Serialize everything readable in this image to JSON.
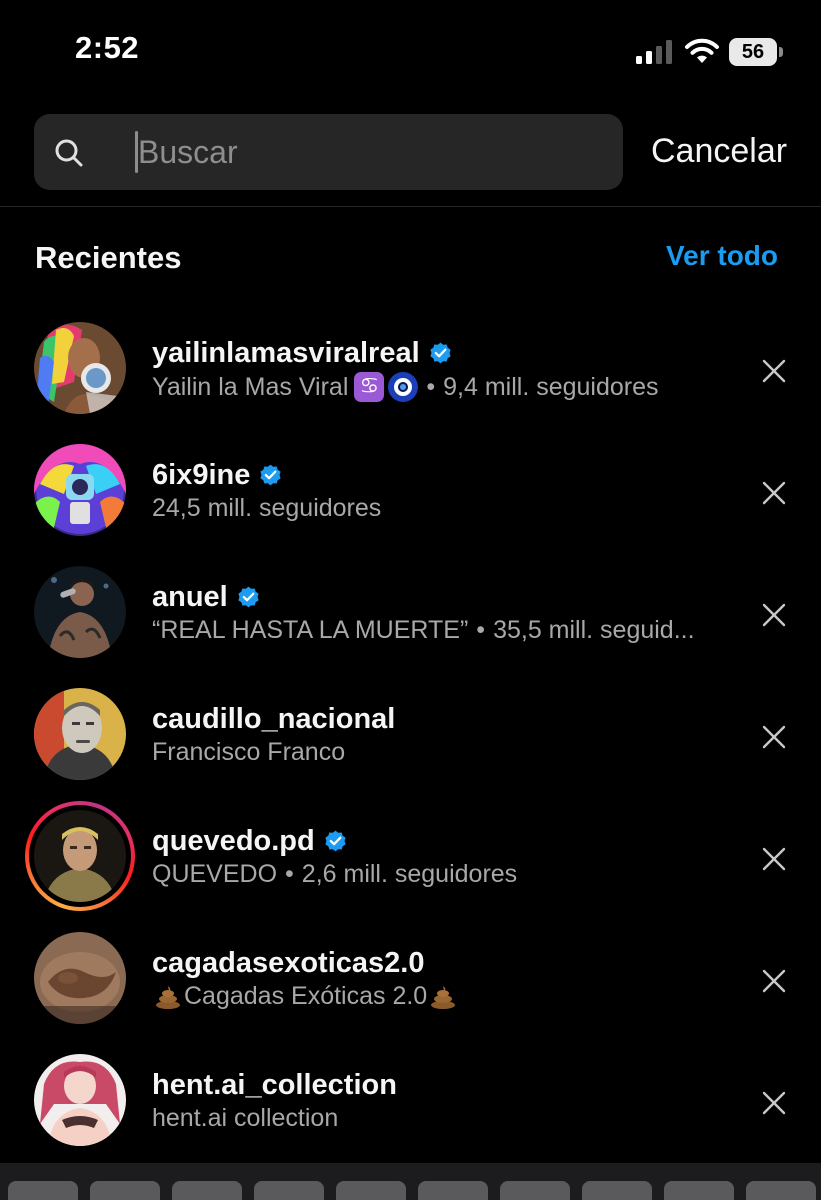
{
  "status_bar": {
    "time": "2:52",
    "battery": "56",
    "icons": [
      "signal-icon",
      "wifi-icon",
      "battery-icon"
    ]
  },
  "search": {
    "placeholder": "Buscar",
    "value": "",
    "cancel_label": "Cancelar"
  },
  "recents": {
    "title": "Recientes",
    "see_all": "Ver todo",
    "items": [
      {
        "username": "yailinlamasviralreal",
        "verified": true,
        "name": "Yailin la Mas Viral",
        "name_emojis": [
          "cancer-emoji",
          "nazar-emoji"
        ],
        "followers": "9,4 mill. seguidores"
      },
      {
        "username": "6ix9ine",
        "verified": true,
        "followers": "24,5 mill. seguidores"
      },
      {
        "username": "anuel",
        "verified": true,
        "name": "“REAL HASTA LA MUERTE”",
        "followers": "35,5 mill. seguid..."
      },
      {
        "username": "caudillo_nacional",
        "verified": false,
        "name": "Francisco Franco"
      },
      {
        "username": "quevedo.pd",
        "verified": true,
        "has_story_ring": true,
        "name": "QUEVEDO",
        "followers": "2,6 mill. seguidores"
      },
      {
        "username": "cagadasexoticas2.0",
        "verified": false,
        "name": "Cagadas Exóticas 2.0",
        "name_emojis": [
          "poop-emoji",
          "poop-emoji"
        ]
      },
      {
        "username": "hent.ai_collection",
        "verified": false,
        "name": "hent.ai collection"
      }
    ]
  },
  "colors": {
    "background": "#000000",
    "search_bg": "#262626",
    "link_blue": "#1a9cf0",
    "verified_blue": "#1d9bf0",
    "secondary_text": "#a8a8a8"
  }
}
